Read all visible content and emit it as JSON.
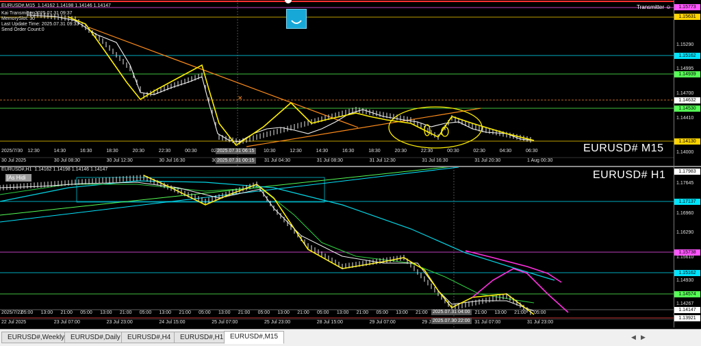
{
  "pane1": {
    "header": "EURUSD#,M15  1.14162 1.14198 1.14146 1.14147",
    "info_lines": [
      "Kai Transmitter 2025.07.31 09:37",
      "MemorySlot: 30",
      "Last Update Time: 2025.07.31 09:33",
      "Send Order Count:0"
    ],
    "symbol_label": "EURUSD# M15",
    "transmitter": "Transmitter ☺",
    "price_ticks": [
      "1.15290",
      "1.14995",
      "1.14700",
      "1.14410",
      "1.14000"
    ],
    "price_tags": [
      {
        "text": "1.15773",
        "color": "#ff55ff"
      },
      {
        "text": "1.15631",
        "color": "#ffd400"
      },
      {
        "text": "1.15162",
        "color": "#00e5ff"
      },
      {
        "text": "1.14939",
        "color": "#55ff55"
      },
      {
        "text": "1.14632",
        "color": "#ffffff"
      },
      {
        "text": "1.14530",
        "color": "#55ff55"
      },
      {
        "text": "1.14130",
        "color": "#ffd400"
      }
    ],
    "time_top": [
      "2025/7/30",
      "12:30",
      "14:30",
      "16:30",
      "18:30",
      "20:30",
      "22:30",
      "00:30",
      "02:30",
      "04:30",
      "10:30",
      "12:30",
      "14:30",
      "16:30",
      "18:30",
      "20:30",
      "22:30",
      "00:30",
      "02:30",
      "04:30",
      "06:30"
    ],
    "time_bottom": [
      "30 Jul 2025",
      "30 Jul 08:30",
      "30 Jul 12:30",
      "30 Jul 16:30",
      "30 Jul 20:30",
      "31 Jul 04:30",
      "31 Jul 08:30",
      "31 Jul 12:30",
      "31 Jul 16:30",
      "31 Jul 20:30",
      "1 Aug 00:30"
    ],
    "cross_time_top": "2025.07.31 06:15",
    "cross_time_bottom": "2025.07.31 00:15"
  },
  "pane2": {
    "header": "EURUSD#,H1  1.14162 1.14198 1.14146 1.14147",
    "button": "[As Hidi",
    "symbol_label": "EURUSD# H1",
    "price_ticks": [
      "1.17645",
      "1.16960",
      "1.16290",
      "1.15610",
      "1.14930",
      "1.14267"
    ],
    "price_tags": [
      {
        "text": "1.17983",
        "color": "#ffffff"
      },
      {
        "text": "1.17137",
        "color": "#00e5ff"
      },
      {
        "text": "1.15738",
        "color": "#ff55ff"
      },
      {
        "text": "1.15162",
        "color": "#00e5ff"
      },
      {
        "text": "1.14574",
        "color": "#55ff55"
      },
      {
        "text": "1.14147",
        "color": "#ffffff"
      },
      {
        "text": "1.13921",
        "color": "#ffffff"
      }
    ],
    "time_top": [
      "2025/7/22",
      "05:00",
      "13:00",
      "21:00",
      "05:00",
      "13:00",
      "21:00",
      "05:00",
      "13:00",
      "21:00",
      "05:00",
      "13:00",
      "21:00",
      "05:00",
      "13:00",
      "21:00",
      "05:00",
      "13:00",
      "21:00",
      "05:00",
      "13:00",
      "21:00",
      "05:00",
      "13:00",
      "21:00",
      "13:00",
      "21:00",
      "05:00"
    ],
    "time_bottom": [
      "22 Jul 2025",
      "23 Jul 07:00",
      "23 Jul 23:00",
      "24 Jul 15:00",
      "25 Jul 07:00",
      "25 Jul 23:00",
      "28 Jul 15:00",
      "29 Jul 07:00",
      "29 Jul 23:00",
      "31 Jul 07:00",
      "31 Jul 23:00"
    ],
    "cross_time_top": "2025.07.31 04:00",
    "cross_time_bottom": "2025.07.30 22:00"
  },
  "tabs": [
    "EURUSD#,Weekly",
    "EURUSD#,Daily",
    "EURUSD#,H4",
    "EURUSD#,H1",
    "EURUSD#,M15"
  ],
  "active_tab": "EURUSD#,M15"
}
